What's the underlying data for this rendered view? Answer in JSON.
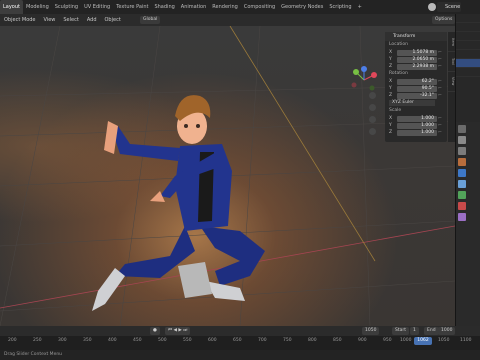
{
  "topbar": {
    "tabs": [
      "Layout",
      "Modeling",
      "Sculpting",
      "UV Editing",
      "Texture Paint",
      "Shading",
      "Animation",
      "Rendering",
      "Compositing",
      "Geometry Nodes",
      "Scripting",
      "+"
    ],
    "scene": "Scene"
  },
  "viewport_header": {
    "items": [
      "Object Mode",
      "View",
      "Select",
      "Add",
      "Object"
    ],
    "transform_orientation": "Global",
    "options": "Options"
  },
  "npanel": {
    "title": "Transform",
    "location_label": "Location",
    "location": [
      {
        "axis": "X",
        "value": "1.5078 m"
      },
      {
        "axis": "Y",
        "value": "2.0650 m"
      },
      {
        "axis": "Z",
        "value": "2.2938 m"
      }
    ],
    "rotation_label": "Rotation",
    "rotation": [
      {
        "axis": "X",
        "value": "62.2°"
      },
      {
        "axis": "Y",
        "value": "90.5°"
      },
      {
        "axis": "Z",
        "value": "-32.1°"
      }
    ],
    "rotation_mode": "XYZ Euler",
    "scale_label": "Scale",
    "scale": [
      {
        "axis": "X",
        "value": "1.000"
      },
      {
        "axis": "Y",
        "value": "1.000"
      },
      {
        "axis": "Z",
        "value": "1.000"
      }
    ],
    "tabs": [
      "Item",
      "Tool",
      "View"
    ]
  },
  "timeline": {
    "start_label": "Start",
    "start": "1",
    "end_label": "End",
    "end": "1000",
    "current": "1050",
    "current_frame": "1062",
    "ticks": [
      "200",
      "250",
      "300",
      "350",
      "400",
      "450",
      "500",
      "550",
      "600",
      "650",
      "700",
      "750",
      "800",
      "850",
      "900",
      "950",
      "1000",
      "1050",
      "1100"
    ]
  },
  "statusbar": {
    "text": "Drag Slider  Context Menu"
  }
}
